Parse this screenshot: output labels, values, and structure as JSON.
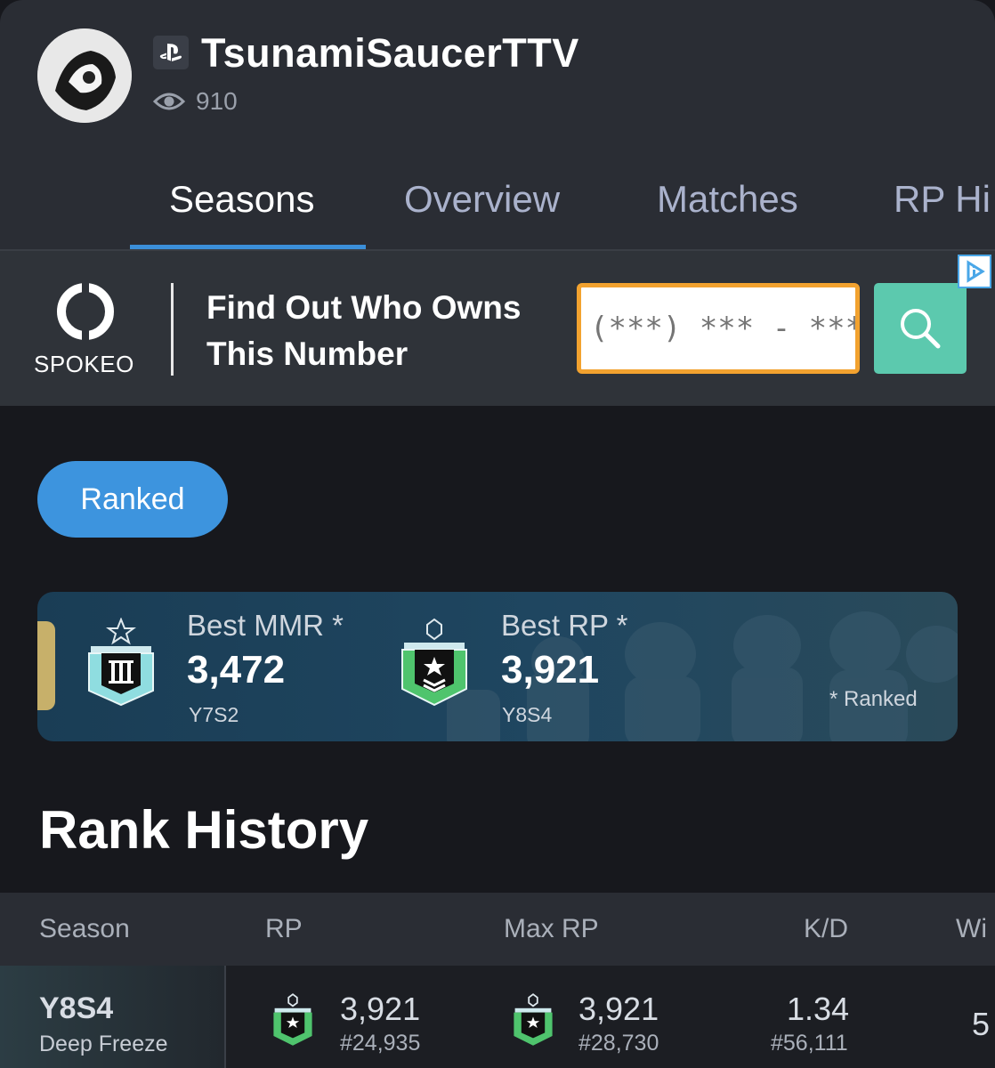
{
  "profile": {
    "platform_icon": "playstation-icon",
    "username": "TsunamiSaucerTTV",
    "views": "910"
  },
  "tabs": [
    {
      "label": "Seasons",
      "active": true
    },
    {
      "label": "Overview",
      "active": false
    },
    {
      "label": "Matches",
      "active": false
    },
    {
      "label": "RP Hi",
      "active": false
    }
  ],
  "ad": {
    "brand": "SPOKEO",
    "headline": "Find Out Who Owns This Number",
    "phone_placeholder": "(***) *** - ****",
    "search_icon": "search-icon",
    "choice_icon": "adchoices-icon",
    "accent_color": "#5cc9ae",
    "input_border_color": "#f2a22f"
  },
  "filter": {
    "mode_label": "Ranked",
    "color": "#3d94de"
  },
  "best": {
    "mmr_label": "Best MMR *",
    "mmr_value": "3,472",
    "mmr_season": "Y7S2",
    "rp_label": "Best RP *",
    "rp_value": "3,921",
    "rp_season": "Y8S4",
    "note": "* Ranked"
  },
  "rank_history": {
    "title": "Rank History",
    "columns": [
      "Season",
      "RP",
      "Max RP",
      "K/D",
      "Wi"
    ],
    "rows": [
      {
        "season": "Y8S4",
        "season_name": "Deep Freeze",
        "rp": "3,921",
        "rp_rank": "#24,935",
        "max_rp": "3,921",
        "max_rp_rank": "#28,730",
        "kd": "1.34",
        "kd_rank": "#56,111",
        "win_partial": "5"
      }
    ]
  }
}
